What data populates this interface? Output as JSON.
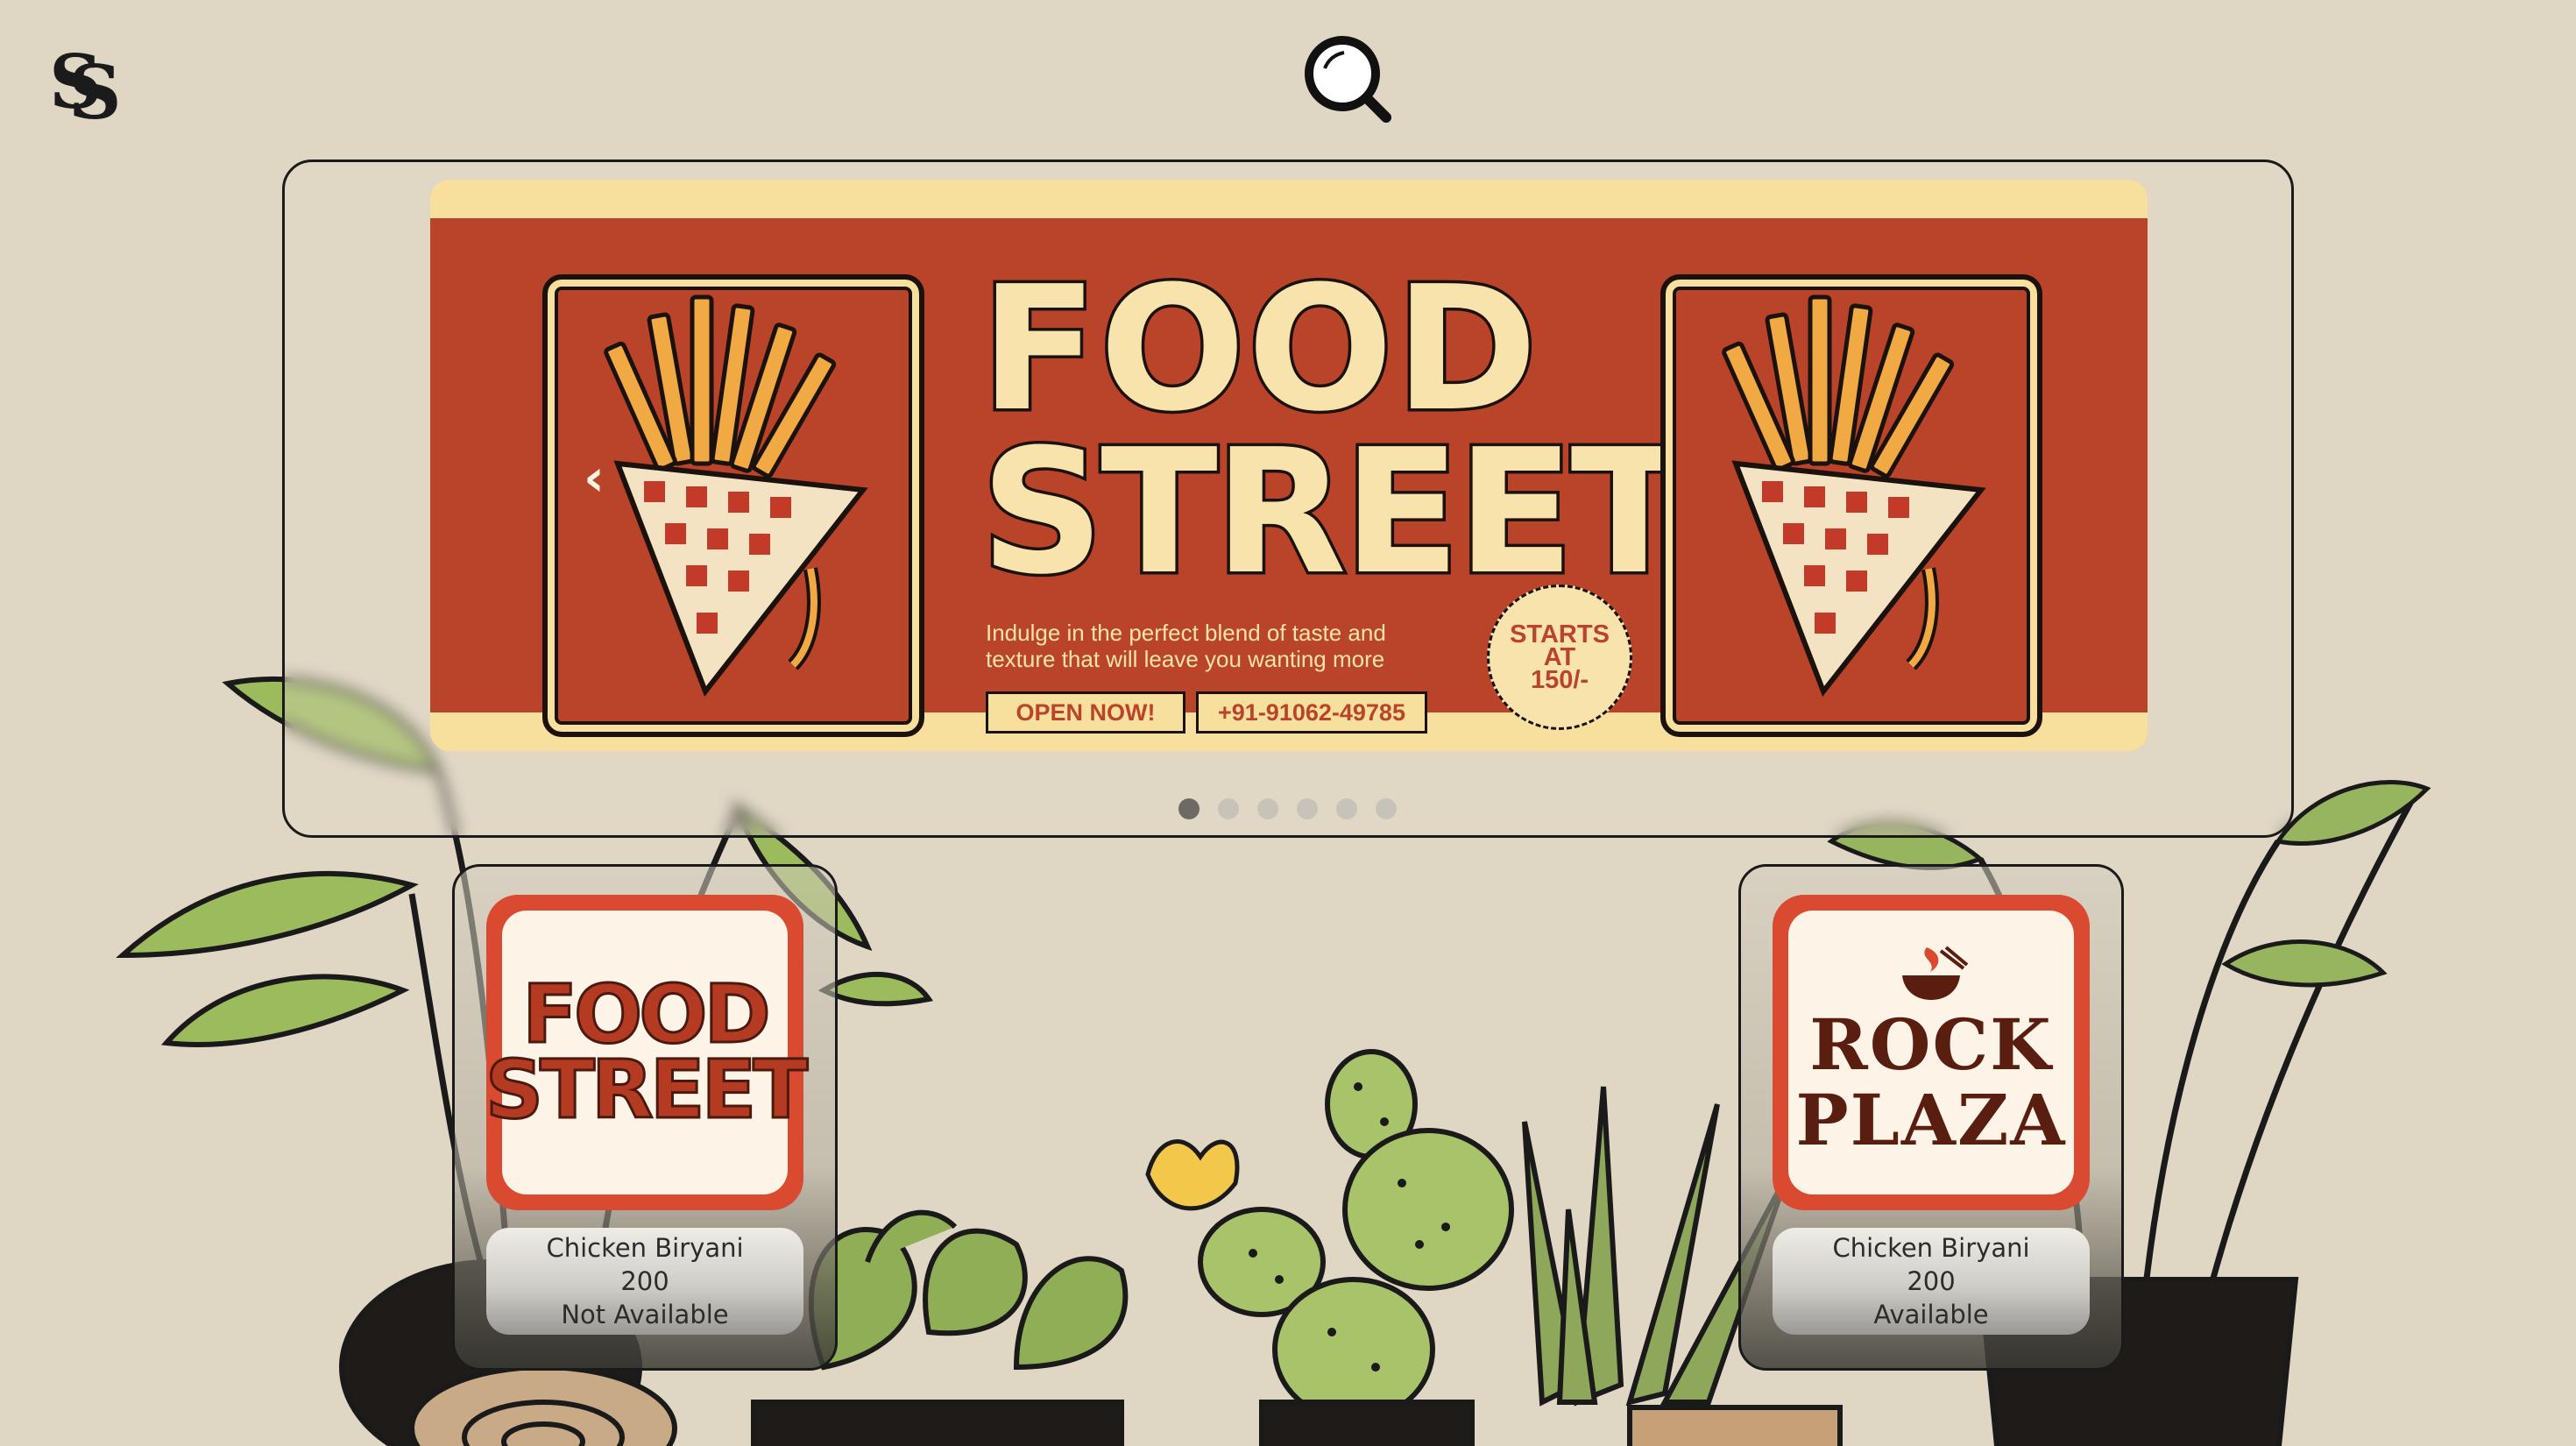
{
  "brand": {
    "logo_text": "SS",
    "logo_first": "S",
    "logo_second": "S"
  },
  "header": {
    "search_icon": "search-icon"
  },
  "carousel": {
    "slides_count": 6,
    "active_index": 0,
    "prev_label": "‹",
    "next_label": "›",
    "banner": {
      "headline_line1": "FOOD",
      "headline_line2": "STREET",
      "tagline_line1": "Indulge in the perfect blend of taste and",
      "tagline_line2": "texture that will leave you wanting more",
      "cta_open": "OPEN NOW!",
      "cta_phone": "+91-91062-49785",
      "badge_line1": "STARTS",
      "badge_line2": "AT",
      "badge_line3": "150/-"
    }
  },
  "restaurants": [
    {
      "logo_line1": "FOOD",
      "logo_line2": "STREET",
      "item": "Chicken Biryani",
      "price": "200",
      "status": "Not Available"
    },
    {
      "logo_line1": "ROCK",
      "logo_line2": "PLAZA",
      "item": "Chicken Biryani",
      "price": "200",
      "status": "Available"
    }
  ],
  "colors": {
    "background": "#dfd6c4",
    "banner_red": "#b9442a",
    "banner_cream": "#f7df9e",
    "plant_green": "#8fae55",
    "outline": "#1a1a1a"
  }
}
